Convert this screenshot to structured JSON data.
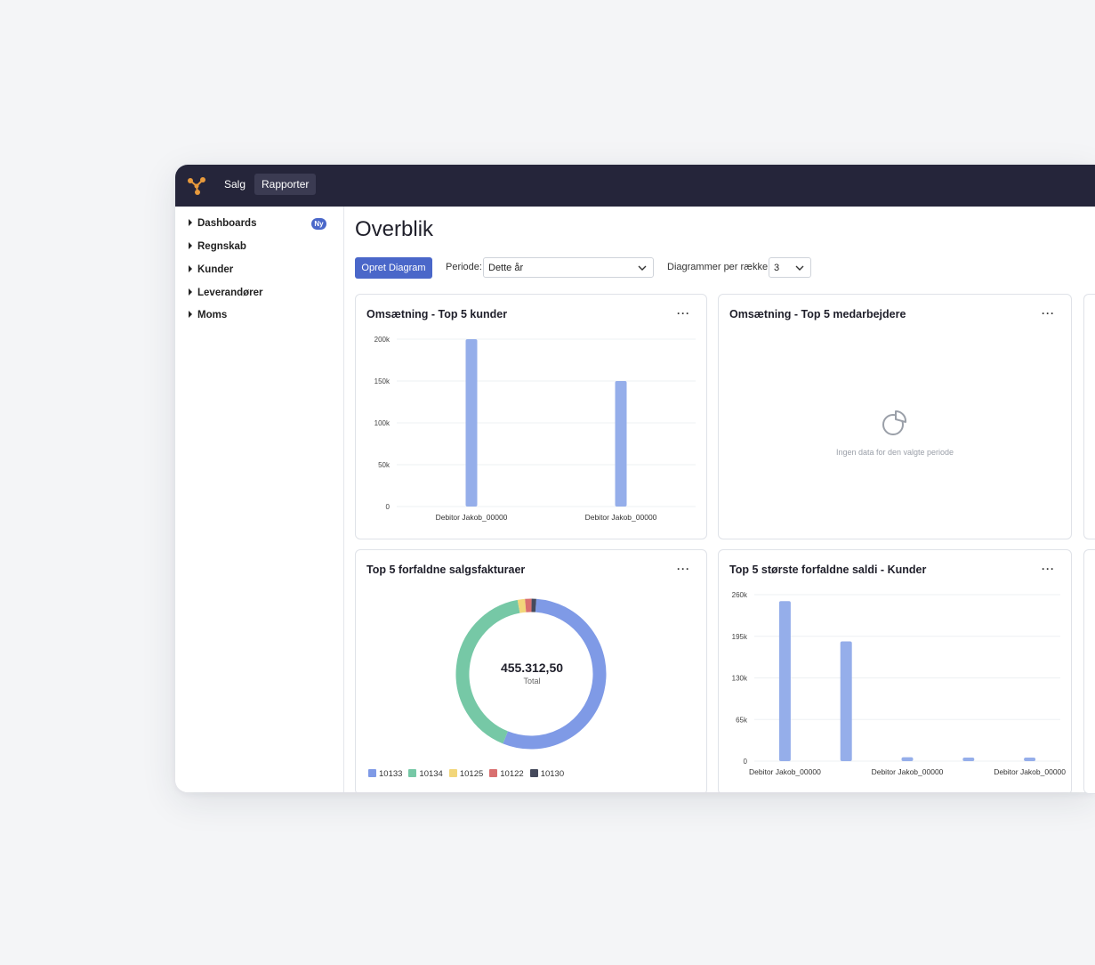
{
  "nav": {
    "salg": "Salg",
    "rapporter": "Rapporter"
  },
  "sidebar": {
    "items": [
      {
        "label": "Dashboards",
        "badge": "Ny"
      },
      {
        "label": "Regnskab"
      },
      {
        "label": "Kunder"
      },
      {
        "label": "Leverandører"
      },
      {
        "label": "Moms"
      }
    ]
  },
  "page": {
    "title": "Overblik",
    "create_button": "Opret Diagram",
    "period_label": "Periode:",
    "period_value": "Dette år",
    "per_row_label": "Diagrammer per række:",
    "per_row_value": "3"
  },
  "cards": {
    "top5_kunder": {
      "title": "Omsætning - Top 5 kunder",
      "menu": "···"
    },
    "top5_medarbejdere": {
      "title": "Omsætning - Top 5 medarbejdere",
      "menu": "···",
      "empty_text": "Ingen data for den valgte periode"
    },
    "forfaldne_fakturaer": {
      "title": "Top 5 forfaldne salgsfakturaer",
      "menu": "···",
      "total_value": "455.312,50",
      "total_label": "Total"
    },
    "forfaldne_saldi": {
      "title": "Top 5 største forfaldne saldi - Kunder",
      "menu": "···"
    }
  },
  "chart_data": [
    {
      "type": "bar",
      "categories": [
        "Debitor Jakob_00000",
        "Debitor Jakob_00000"
      ],
      "values": [
        200000,
        150000
      ],
      "yticks": [
        "0",
        "50k",
        "100k",
        "150k",
        "200k"
      ],
      "ylim": [
        0,
        200000
      ],
      "color": "#95aeea"
    },
    {
      "type": "pie",
      "labels": [
        "10133",
        "10134",
        "10125",
        "10122",
        "10130"
      ],
      "values": [
        55,
        41,
        1.6,
        1.4,
        1.0
      ],
      "colors": [
        "#7f9ae6",
        "#76c8a6",
        "#f2d67a",
        "#d96f6f",
        "#454a5c"
      ],
      "center_value": "455.312,50",
      "center_label": "Total"
    },
    {
      "type": "bar",
      "categories": [
        "Debitor Jakob_00000",
        "",
        "Debitor Jakob_00000",
        "",
        "Debitor Jakob_00000"
      ],
      "values": [
        250000,
        187000,
        6000,
        5000,
        5000
      ],
      "yticks": [
        "0",
        "65k",
        "130k",
        "195k",
        "260k"
      ],
      "ylim": [
        0,
        260000
      ],
      "color": "#95aeea"
    }
  ]
}
